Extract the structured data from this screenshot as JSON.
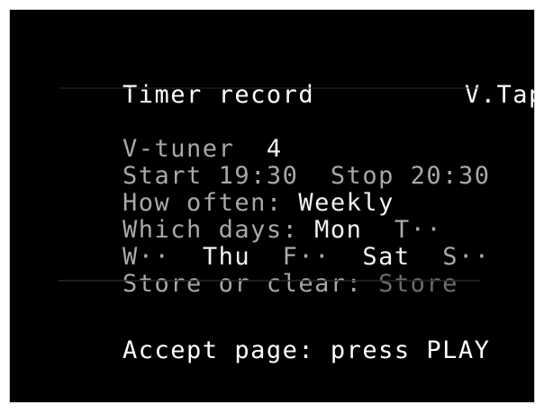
{
  "header": {
    "title": "Timer record",
    "mode": "V.Tape"
  },
  "fields": {
    "tuner_label": "V-tuner",
    "tuner_value": "4",
    "start_label": "Start",
    "start_value": "19:30",
    "stop_label": "Stop",
    "stop_value": "20:30",
    "often_label": "How often:",
    "often_value": "Weekly",
    "days_label": "Which days:",
    "day_mon": "Mon",
    "day_tue": "T··",
    "day_wed": "W··",
    "day_thu": "Thu",
    "day_fri": "F··",
    "day_sat": "Sat",
    "day_sun": "S··",
    "store_label": "Store or clear:",
    "store_value": "Store"
  },
  "footer": {
    "prompt": "Accept page: press PLAY"
  },
  "colors": {
    "background": "#000000",
    "text_bright": "#ffffff",
    "text_dim": "#a8a8a8"
  }
}
